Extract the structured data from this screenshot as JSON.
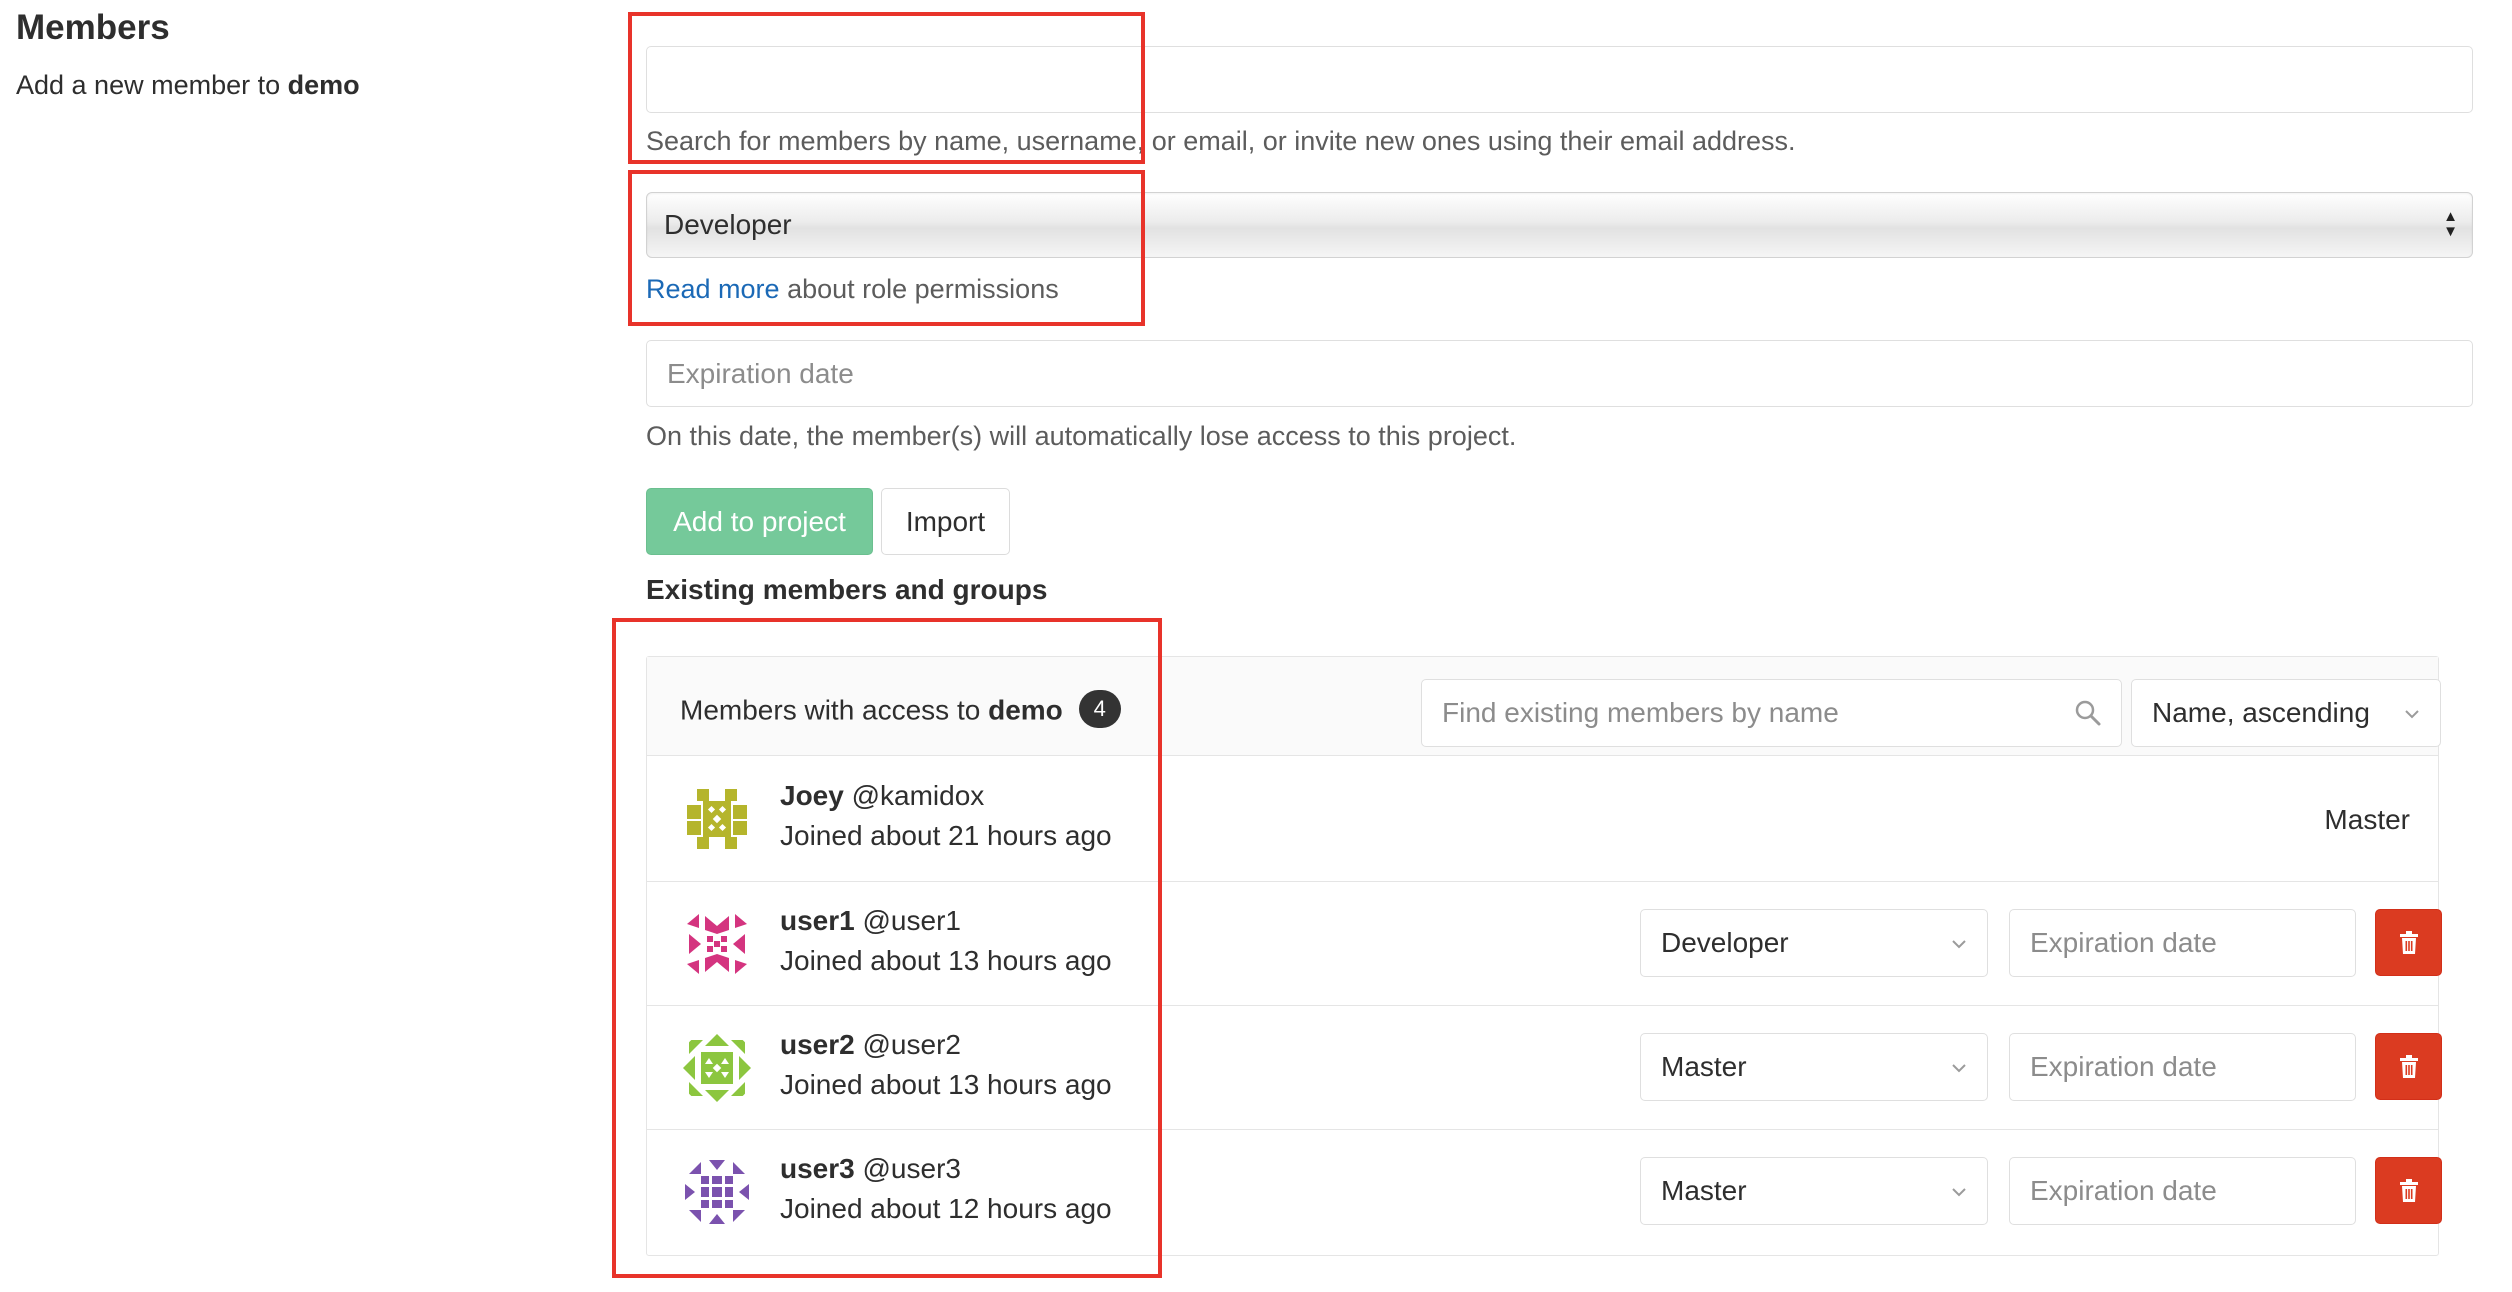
{
  "section": {
    "title": "Members",
    "description_prefix": "Add a new member to ",
    "project_name": "demo"
  },
  "invite": {
    "search_value": "",
    "search_help": "Search for members by name, username, or email, or invite new ones using their email address.",
    "role_selected": "Developer",
    "read_more_link": "Read more",
    "read_more_suffix": " about role permissions",
    "expiration_placeholder": "Expiration date",
    "expiration_help": "On this date, the member(s) will automatically lose access to this project.",
    "add_button": "Add to project",
    "import_button": "Import"
  },
  "existing": {
    "heading": "Existing members and groups",
    "panel_title_prefix": "Members with access to ",
    "project_name": "demo",
    "count": "4",
    "find_placeholder": "Find existing members by name",
    "sort_selected": "Name, ascending",
    "members": [
      {
        "name": "Joey",
        "username": "@kamidox",
        "joined": "Joined about 21 hours ago",
        "role": "Master",
        "editable": false,
        "avatar_color": "#b5b52c"
      },
      {
        "name": "user1",
        "username": "@user1",
        "joined": "Joined about 13 hours ago",
        "role": "Developer",
        "editable": true,
        "expiration_placeholder": "Expiration date",
        "avatar_color": "#d4347f"
      },
      {
        "name": "user2",
        "username": "@user2",
        "joined": "Joined about 13 hours ago",
        "role": "Master",
        "editable": true,
        "expiration_placeholder": "Expiration date",
        "avatar_color": "#8cc63f"
      },
      {
        "name": "user3",
        "username": "@user3",
        "joined": "Joined about 12 hours ago",
        "role": "Master",
        "editable": true,
        "expiration_placeholder": "Expiration date",
        "avatar_color": "#7b52ae"
      }
    ]
  },
  "colors": {
    "highlight": "#e8332a",
    "add_button": "#75c99a",
    "delete_button": "#db3b21",
    "link": "#1b69b6"
  },
  "icons": [
    "search-icon",
    "chevron-down-icon",
    "trash-icon",
    "select-arrows-icon"
  ]
}
